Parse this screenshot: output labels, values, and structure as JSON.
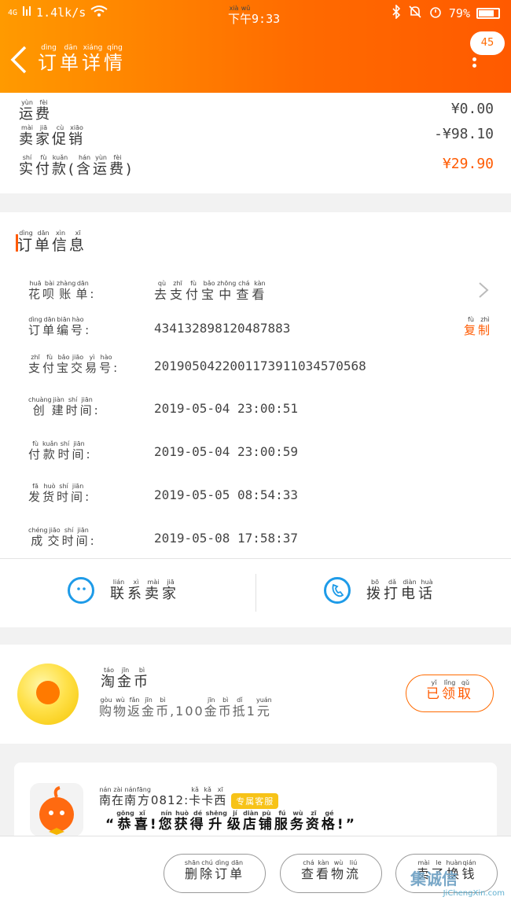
{
  "status": {
    "network": "4G",
    "speed": "1.4lk/s",
    "time_ruby": [
      "下",
      "午"
    ],
    "time_pinyin": [
      "xià",
      "wǔ"
    ],
    "time": "9:33",
    "battery": "79%",
    "battery_level": 0.79
  },
  "header": {
    "title_chars": [
      "订",
      "单",
      "详",
      "情"
    ],
    "title_pinyin": [
      "dìng",
      "dān",
      "xiáng",
      "qíng"
    ],
    "badge": "45"
  },
  "summary": {
    "rows": [
      {
        "chars": [
          "运",
          "费"
        ],
        "pinyin": [
          "yùn",
          "fèi"
        ],
        "value": "¥0.00"
      },
      {
        "chars": [
          "卖",
          "家",
          "促",
          "销"
        ],
        "pinyin": [
          "mài",
          "jiā",
          "cù",
          "xiāo"
        ],
        "value": "-¥98.10"
      },
      {
        "chars": [
          "实",
          "付",
          "款",
          "(",
          "含",
          "运",
          "费",
          ")"
        ],
        "pinyin": [
          "shí",
          "fù",
          "kuǎn",
          "",
          "hán",
          "yùn",
          "fèi",
          ""
        ],
        "value": "¥29.90"
      }
    ]
  },
  "order_info": {
    "title_chars": [
      "订",
      "单",
      "信",
      "息"
    ],
    "title_pinyin": [
      "dìng",
      "dān",
      "xìn",
      "xī"
    ],
    "rows": [
      {
        "chars": [
          "花",
          "呗",
          "账",
          "单",
          ":"
        ],
        "pinyin": [
          "huā",
          "bài",
          "zhàng",
          "dān",
          ""
        ],
        "value_chars": [
          "去",
          "支",
          "付",
          "宝",
          "中",
          "查",
          "看"
        ],
        "value_pinyin": [
          "qù",
          "zhī",
          "fù",
          "bǎo",
          "zhōng",
          "chá",
          "kàn"
        ]
      },
      {
        "chars": [
          "订",
          "单",
          "编",
          "号",
          ":"
        ],
        "pinyin": [
          "dìng",
          "dān",
          "biān",
          "hào",
          ""
        ],
        "value": "434132898120487883"
      },
      {
        "chars": [
          "支",
          "付",
          "宝",
          "交",
          "易",
          "号",
          ":"
        ],
        "pinyin": [
          "zhī",
          "fù",
          "bǎo",
          "jiāo",
          "yì",
          "hào",
          ""
        ],
        "value": "2019050422001173911034570568"
      },
      {
        "chars": [
          "创",
          "建",
          "时",
          "间",
          ":"
        ],
        "pinyin": [
          "chuàng",
          "jiàn",
          "shí",
          "jiān",
          ""
        ],
        "value": "2019-05-04 23:00:51"
      },
      {
        "chars": [
          "付",
          "款",
          "时",
          "间",
          ":"
        ],
        "pinyin": [
          "fù",
          "kuǎn",
          "shí",
          "jiān",
          ""
        ],
        "value": "2019-05-04 23:00:59"
      },
      {
        "chars": [
          "发",
          "货",
          "时",
          "间",
          ":"
        ],
        "pinyin": [
          "fā",
          "huò",
          "shí",
          "jiān",
          ""
        ],
        "value": "2019-05-05 08:54:33"
      },
      {
        "chars": [
          "成",
          "交",
          "时",
          "间",
          ":"
        ],
        "pinyin": [
          "chéng",
          "jiāo",
          "shí",
          "jiān",
          ""
        ],
        "value": "2019-05-08 17:58:37"
      }
    ],
    "copy_chars": [
      "复",
      "制"
    ],
    "copy_pinyin": [
      "fù",
      "zhì"
    ],
    "actions": [
      {
        "chars": [
          "联",
          "系",
          "卖",
          "家"
        ],
        "pinyin": [
          "lián",
          "xì",
          "mài",
          "jiā"
        ],
        "icon": "chat-face-icon"
      },
      {
        "chars": [
          "拨",
          "打",
          "电",
          "话"
        ],
        "pinyin": [
          "bō",
          "dǎ",
          "diàn",
          "huà"
        ],
        "icon": "phone-icon"
      }
    ]
  },
  "coin": {
    "title_chars": [
      "淘",
      "金",
      "币"
    ],
    "title_pinyin": [
      "táo",
      "jīn",
      "bì"
    ],
    "sub_chars": [
      "购",
      "物",
      "返",
      "金",
      "币",
      ",",
      "100",
      "金",
      "币",
      "抵",
      "1",
      "元"
    ],
    "sub_pinyin": [
      "gòu",
      "wù",
      "fǎn",
      "jīn",
      "bì",
      "",
      "",
      "jīn",
      "bì",
      "dǐ",
      "",
      "yuán"
    ],
    "button_chars": [
      "已",
      "领",
      "取"
    ],
    "button_pinyin": [
      "yǐ",
      "lǐng",
      "qǔ"
    ]
  },
  "shop": {
    "name_chars": [
      "南",
      "在",
      "南",
      "方",
      "0812",
      ":",
      "卡",
      "卡",
      "西"
    ],
    "name_pinyin": [
      "nán",
      "zài",
      "nán",
      "fāng",
      "",
      "",
      "kǎ",
      "kǎ",
      "xī"
    ],
    "tag": "专属客服",
    "message_chars": [
      "“",
      "恭",
      "喜",
      "!",
      "您",
      "获",
      "得",
      "升",
      "级",
      "店",
      "铺",
      "服",
      "务",
      "资",
      "格",
      "!",
      "”"
    ],
    "message_pinyin": [
      "",
      "gōng",
      "xǐ",
      "",
      "nín",
      "huò",
      "dé",
      "shēng",
      "jí",
      "diàn",
      "pù",
      "fú",
      "wù",
      "zī",
      "gé",
      "",
      ""
    ]
  },
  "bottom": {
    "buttons": [
      {
        "chars": [
          "删",
          "除",
          "订",
          "单"
        ],
        "pinyin": [
          "shān",
          "chú",
          "dìng",
          "dān"
        ]
      },
      {
        "chars": [
          "查",
          "看",
          "物",
          "流"
        ],
        "pinyin": [
          "chá",
          "kàn",
          "wù",
          "liú"
        ]
      },
      {
        "chars": [
          "卖",
          "了",
          "换",
          "钱"
        ],
        "pinyin": [
          "mài",
          "le",
          "huàn",
          "qián"
        ]
      }
    ]
  },
  "watermark": {
    "cn": "集诚信",
    "en": "JiChengXin.com"
  },
  "colors": {
    "accent": "#ff6a00",
    "price": "#ff5a00",
    "icon_blue": "#1e9be8"
  }
}
